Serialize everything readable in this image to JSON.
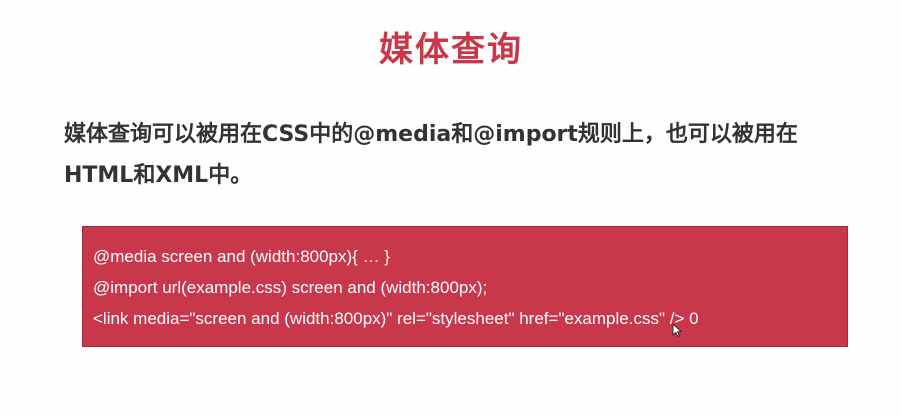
{
  "slide": {
    "title": "媒体查询",
    "body_lines": [
      "媒体查询可以被用在CSS中的@media和@import规则上，也可以被用在",
      "HTML和XML中。"
    ],
    "code_lines": [
      "@media screen and (width:800px){ … }",
      "@import url(example.css) screen and (width:800px);",
      " <link media=\"screen and (width:800px)\" rel=\"stylesheet\" href=\"example.css\" /> 0"
    ]
  },
  "colors": {
    "title": "#c9384a",
    "code_box_bg": "#c9384a",
    "code_text": "#ffffff",
    "body_text": "#333333"
  },
  "icons": {
    "cursor": "mouse-pointer-icon"
  }
}
